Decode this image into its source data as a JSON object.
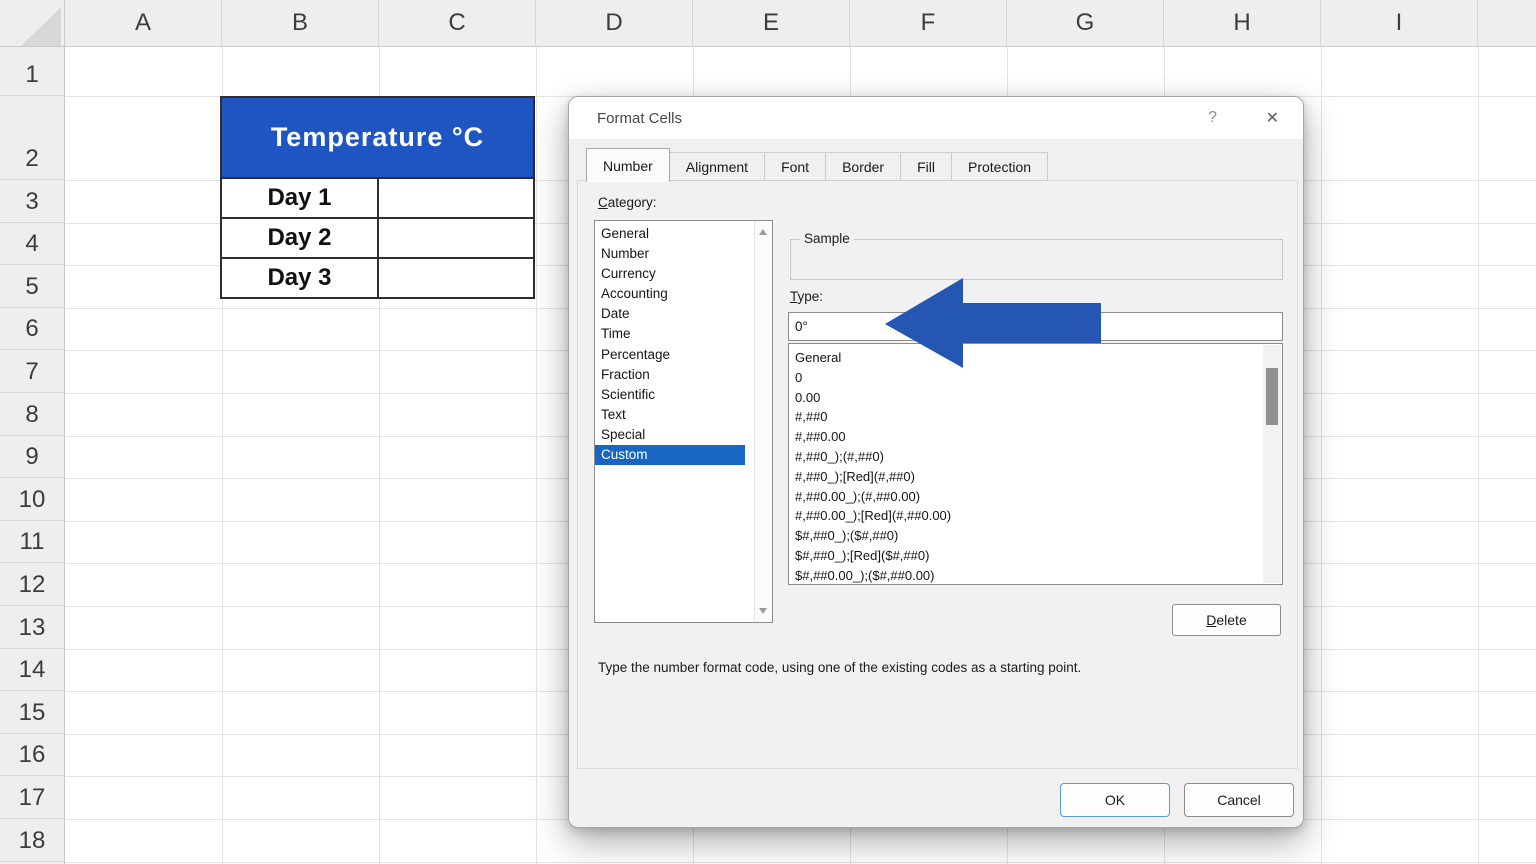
{
  "spreadsheet": {
    "columns": [
      "A",
      "B",
      "C",
      "D",
      "E",
      "F",
      "G",
      "H",
      "I"
    ],
    "rows": [
      "1",
      "2",
      "3",
      "4",
      "5",
      "6",
      "7",
      "8",
      "9",
      "10",
      "11",
      "12",
      "13",
      "14",
      "15",
      "16",
      "17",
      "18"
    ],
    "table": {
      "header": "Temperature °C",
      "header_bg": "#1e55c3",
      "rows": [
        "Day 1",
        "Day 2",
        "Day 3"
      ]
    }
  },
  "dialog": {
    "title": "Format Cells",
    "help_icon": "?",
    "close_icon": "✕",
    "tabs": [
      {
        "label": "Number",
        "active": true
      },
      {
        "label": "Alignment",
        "active": false
      },
      {
        "label": "Font",
        "active": false
      },
      {
        "label": "Border",
        "active": false
      },
      {
        "label": "Fill",
        "active": false
      },
      {
        "label": "Protection",
        "active": false
      }
    ],
    "category": {
      "label": "Category:",
      "items": [
        "General",
        "Number",
        "Currency",
        "Accounting",
        "Date",
        "Time",
        "Percentage",
        "Fraction",
        "Scientific",
        "Text",
        "Special",
        "Custom"
      ],
      "selected": "Custom",
      "selection_color": "#1766c4"
    },
    "sample": {
      "label": "Sample",
      "value": ""
    },
    "type": {
      "label": "Type:",
      "value": "0°"
    },
    "format_codes": [
      "General",
      "0",
      "0.00",
      "#,##0",
      "#,##0.00",
      "#,##0_);(#,##0)",
      "#,##0_);[Red](#,##0)",
      "#,##0.00_);(#,##0.00)",
      "#,##0.00_);[Red](#,##0.00)",
      "$#,##0_);($#,##0)",
      "$#,##0_);[Red]($#,##0)",
      "$#,##0.00_);($#,##0.00)"
    ],
    "delete_button": "Delete",
    "help_text": "Type the number format code, using one of the existing codes as a starting point.",
    "ok_button": "OK",
    "cancel_button": "Cancel",
    "focus_ring": "#5b9bd5"
  },
  "annotation": {
    "arrow_color": "#2456b2"
  }
}
